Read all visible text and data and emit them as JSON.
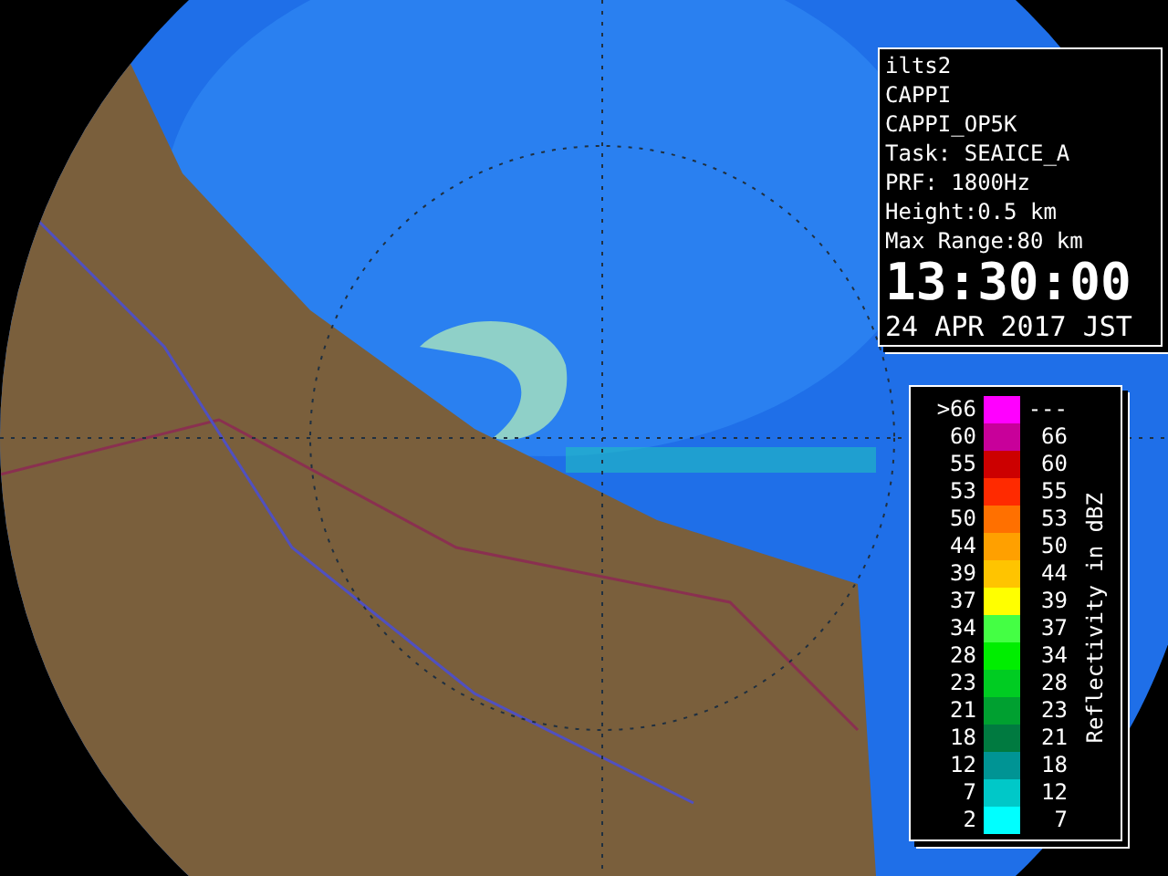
{
  "info_panel": {
    "lines": [
      "ilts2",
      "CAPPI",
      "CAPPI_OP5K",
      "Task: SEAICE_A",
      "PRF: 1800Hz",
      "Height:0.5 km",
      "Max Range:80 km"
    ],
    "time": "13:30:00",
    "date": "24 APR 2017 JST"
  },
  "legend": {
    "title": "Reflectivity in dBZ",
    "rows": [
      {
        "low": ">66",
        "high": "---",
        "color": "#ff00ff"
      },
      {
        "low": "60",
        "high": "66",
        "color": "#c8009a"
      },
      {
        "low": "55",
        "high": "60",
        "color": "#cc0000"
      },
      {
        "low": "53",
        "high": "55",
        "color": "#ff2a00"
      },
      {
        "low": "50",
        "high": "53",
        "color": "#ff7000"
      },
      {
        "low": "44",
        "high": "50",
        "color": "#ffa000"
      },
      {
        "low": "39",
        "high": "44",
        "color": "#ffc400"
      },
      {
        "low": "37",
        "high": "39",
        "color": "#ffff00"
      },
      {
        "low": "34",
        "high": "37",
        "color": "#44ff44"
      },
      {
        "low": "28",
        "high": "34",
        "color": "#00ee00"
      },
      {
        "low": "23",
        "high": "28",
        "color": "#00cc22"
      },
      {
        "low": "21",
        "high": "23",
        "color": "#00a030"
      },
      {
        "low": "18",
        "high": "21",
        "color": "#007a40"
      },
      {
        "low": "12",
        "high": "18",
        "color": "#009494"
      },
      {
        "low": "7",
        "high": "12",
        "color": "#00c8c8"
      },
      {
        "low": "2",
        "high": "7",
        "color": "#00ffff"
      }
    ]
  }
}
